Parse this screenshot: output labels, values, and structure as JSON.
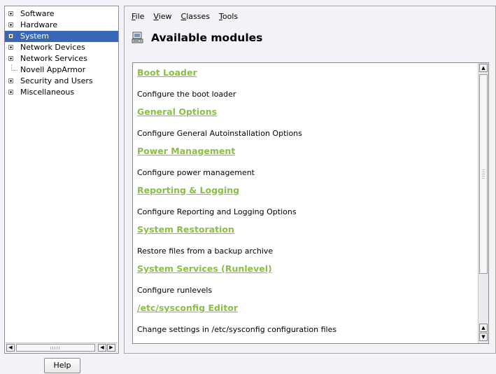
{
  "tree": {
    "items": [
      {
        "label": "Software",
        "expandable": true,
        "selected": false
      },
      {
        "label": "Hardware",
        "expandable": true,
        "selected": false
      },
      {
        "label": "System",
        "expandable": true,
        "selected": true
      },
      {
        "label": "Network Devices",
        "expandable": true,
        "selected": false
      },
      {
        "label": "Network Services",
        "expandable": true,
        "selected": false
      },
      {
        "label": "Novell AppArmor",
        "expandable": false,
        "selected": false
      },
      {
        "label": "Security and Users",
        "expandable": true,
        "selected": false
      },
      {
        "label": "Miscellaneous",
        "expandable": true,
        "selected": false
      }
    ],
    "scroll_left_icon": "arrow-left-icon",
    "scroll_right_icon": "arrow-right-icon"
  },
  "help_button": {
    "label": "Help"
  },
  "menu": {
    "items": [
      {
        "mnemonic": "F",
        "rest": "ile"
      },
      {
        "mnemonic": "V",
        "rest": "iew"
      },
      {
        "mnemonic": "C",
        "rest": "lasses"
      },
      {
        "mnemonic": "T",
        "rest": "ools"
      }
    ]
  },
  "header": {
    "title": "Available modules",
    "icon": "modules-icon"
  },
  "modules": [
    {
      "name": "Boot Loader",
      "description": "Configure the boot loader"
    },
    {
      "name": "General Options",
      "description": "Configure General Autoinstallation Options"
    },
    {
      "name": "Power Management",
      "description": "Configure power management"
    },
    {
      "name": "Reporting & Logging",
      "description": "Configure Reporting and Logging Options"
    },
    {
      "name": "System Restoration",
      "description": "Restore files from a backup archive"
    },
    {
      "name": "System Services (Runlevel)",
      "description": "Configure runlevels"
    },
    {
      "name": "/etc/sysconfig Editor",
      "description": "Change settings in /etc/sysconfig configuration files"
    }
  ],
  "colors": {
    "selection": "#3768b7",
    "link": "#8bbf43",
    "background": "#f4f1f8"
  }
}
